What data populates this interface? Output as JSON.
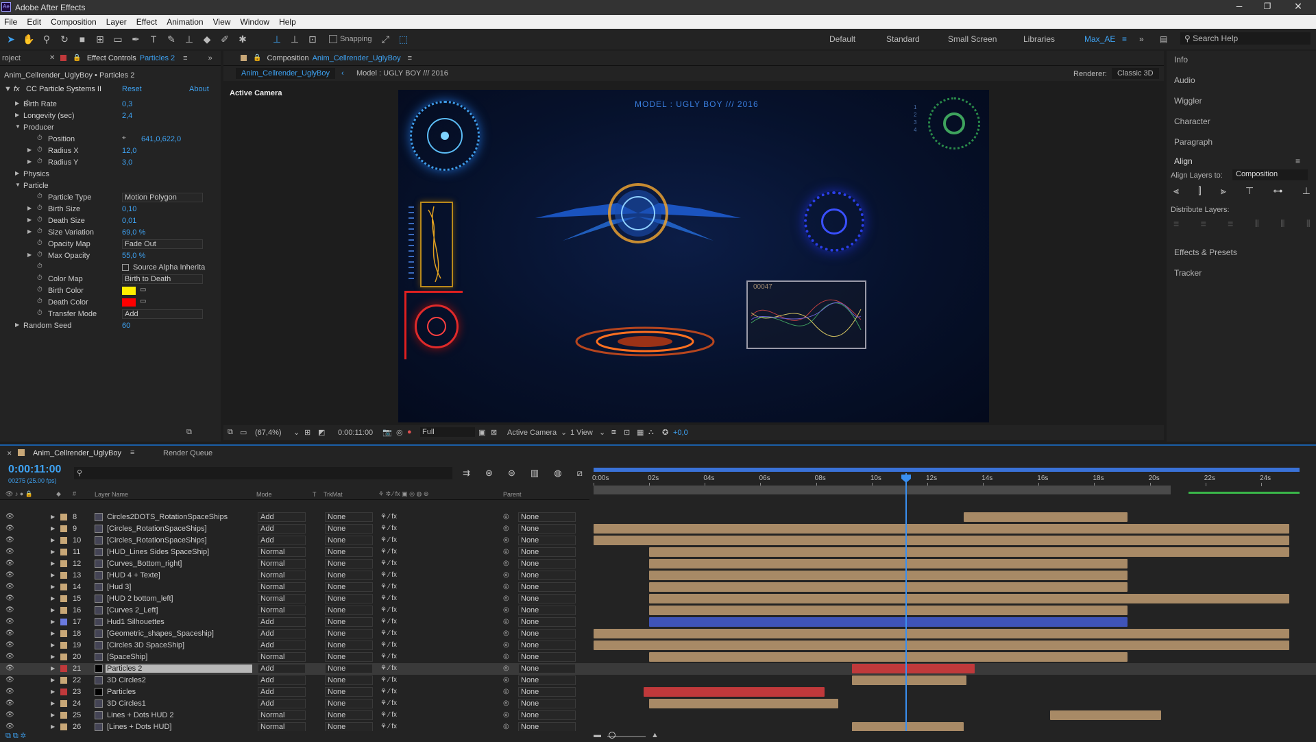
{
  "app": {
    "title": "Adobe After Effects",
    "icon": "Ae"
  },
  "menu": [
    "File",
    "Edit",
    "Composition",
    "Layer",
    "Effect",
    "Animation",
    "View",
    "Window",
    "Help"
  ],
  "toolbar": {
    "snapping_label": "Snapping",
    "search_placeholder": "Search Help"
  },
  "workspaces": [
    "Default",
    "Standard",
    "Small Screen",
    "Libraries",
    "Max_AE"
  ],
  "effect_panel": {
    "tab_project": "roject",
    "tab_label": "Effect Controls",
    "tab_layer": "Particles 2",
    "breadcrumb": "Anim_Cellrender_UglyBoy • Particles 2",
    "effect_name": "CC Particle Systems II",
    "reset": "Reset",
    "about": "About",
    "rows": [
      {
        "label": "Birth Rate",
        "value": "0,3"
      },
      {
        "label": "Longevity (sec)",
        "value": "2,4"
      },
      {
        "label": "Producer",
        "value": ""
      },
      {
        "label": "Position",
        "value": "641,0,622,0"
      },
      {
        "label": "Radius X",
        "value": "12,0"
      },
      {
        "label": "Radius Y",
        "value": "3,0"
      },
      {
        "label": "Physics",
        "value": ""
      },
      {
        "label": "Particle",
        "value": ""
      },
      {
        "label": "Particle Type",
        "value": "Motion Polygon"
      },
      {
        "label": "Birth Size",
        "value": "0,10"
      },
      {
        "label": "Death Size",
        "value": "0,01"
      },
      {
        "label": "Size Variation",
        "value": "69,0 %"
      },
      {
        "label": "Opacity Map",
        "value": "Fade Out"
      },
      {
        "label": "Max Opacity",
        "value": "55,0 %"
      },
      {
        "label": "",
        "value": "Source Alpha Inherita"
      },
      {
        "label": "Color Map",
        "value": "Birth to Death"
      },
      {
        "label": "Birth Color",
        "value": ""
      },
      {
        "label": "Death Color",
        "value": ""
      },
      {
        "label": "Transfer Mode",
        "value": "Add"
      },
      {
        "label": "Random Seed",
        "value": "60"
      }
    ],
    "colors": {
      "birth": "#ffee00",
      "death": "#ff0000"
    }
  },
  "composition": {
    "tab_prefix": "Composition",
    "tab_name": "Anim_Cellrender_UglyBoy",
    "sub_tab": "Anim_Cellrender_UglyBoy",
    "model_label": "Model : UGLY BOY /// 2016",
    "renderer_label": "Renderer:",
    "renderer": "Classic 3D",
    "view_label": "Active Camera",
    "overlay_title": "MODEL : UGLY BOY /// 2016",
    "counter": "00047",
    "side_digits": "1 2 3 4"
  },
  "viewer_bar": {
    "zoom": "(67,4%)",
    "time": "0:00:11:00",
    "resolution": "Full",
    "camera": "Active Camera",
    "views": "1 View",
    "exposure": "+0,0"
  },
  "right_panel": {
    "items": [
      "Info",
      "Audio",
      "Wiggler",
      "Character",
      "Paragraph"
    ],
    "align_title": "Align",
    "align_to_label": "Align Layers to:",
    "align_to": "Composition",
    "distribute_label": "Distribute Layers:",
    "tail": [
      "Effects & Presets",
      "Tracker"
    ]
  },
  "timeline": {
    "tab": "Anim_Cellrender_UglyBoy",
    "render_queue": "Render Queue",
    "timecode": "0:00:11:00",
    "frames": "00275 (25.00 fps)",
    "col_headers": {
      "layer": "Layer Name",
      "mode": "Mode",
      "t": "T",
      "trkmat": "TrkMat",
      "parent": "Parent"
    },
    "ruler": [
      "0:00s",
      "02s",
      "04s",
      "06s",
      "08s",
      "10s",
      "12s",
      "14s",
      "16s",
      "18s",
      "20s",
      "22s",
      "24s"
    ],
    "layers": [
      {
        "num": "8",
        "name": "Circles2DOTS_RotationSpaceShips",
        "mode": "Add",
        "trk": "None",
        "parent": "None",
        "color": "#a88a66",
        "start": 13.3,
        "end": 19.2
      },
      {
        "num": "9",
        "name": "[Circles_RotationSpaceShips]",
        "mode": "Add",
        "trk": "None",
        "parent": "None",
        "color": "#a88a66",
        "start": 0,
        "end": 25
      },
      {
        "num": "10",
        "name": "[Circles_RotationSpaceShips]",
        "mode": "Add",
        "trk": "None",
        "parent": "None",
        "color": "#a88a66",
        "start": 0,
        "end": 25
      },
      {
        "num": "11",
        "name": "[HUD_Lines Sides SpaceShip]",
        "mode": "Normal",
        "trk": "None",
        "parent": "None",
        "color": "#a88a66",
        "start": 2,
        "end": 25
      },
      {
        "num": "12",
        "name": "[Curves_Bottom_right]",
        "mode": "Normal",
        "trk": "None",
        "parent": "None",
        "color": "#a88a66",
        "start": 2,
        "end": 19.2
      },
      {
        "num": "13",
        "name": "[HUD 4 + Texte]",
        "mode": "Normal",
        "trk": "None",
        "parent": "None",
        "color": "#a88a66",
        "start": 2,
        "end": 19.2
      },
      {
        "num": "14",
        "name": "[Hud 3]",
        "mode": "Normal",
        "trk": "None",
        "parent": "None",
        "color": "#a88a66",
        "start": 2,
        "end": 19.2
      },
      {
        "num": "15",
        "name": "[HUD 2 bottom_left]",
        "mode": "Normal",
        "trk": "None",
        "parent": "None",
        "color": "#a88a66",
        "start": 2,
        "end": 25
      },
      {
        "num": "16",
        "name": "[Curves 2_Left]",
        "mode": "Normal",
        "trk": "None",
        "parent": "None",
        "color": "#a88a66",
        "start": 2,
        "end": 19.2
      },
      {
        "num": "17",
        "name": "Hud1 Silhouettes",
        "mode": "Add",
        "trk": "None",
        "parent": "None",
        "color": "#3f54b8",
        "start": 2,
        "end": 19.2
      },
      {
        "num": "18",
        "name": "[Geometric_shapes_Spaceship]",
        "mode": "Add",
        "trk": "None",
        "parent": "None",
        "color": "#a88a66",
        "start": 0,
        "end": 25
      },
      {
        "num": "19",
        "name": "[Circles 3D SpaceShip]",
        "mode": "Add",
        "trk": "None",
        "parent": "None",
        "color": "#a88a66",
        "start": 0,
        "end": 25
      },
      {
        "num": "20",
        "name": "[SpaceShip]",
        "mode": "Normal",
        "trk": "None",
        "parent": "None",
        "color": "#a88a66",
        "start": 2,
        "end": 19.2
      },
      {
        "num": "21",
        "name": "Particles 2",
        "mode": "Add",
        "trk": "None",
        "parent": "None",
        "color": "#c0393b",
        "start": 9.3,
        "end": 13.7
      },
      {
        "num": "22",
        "name": "3D Circles2",
        "mode": "Add",
        "trk": "None",
        "parent": "None",
        "color": "#a88a66",
        "start": 9.3,
        "end": 13.4
      },
      {
        "num": "23",
        "name": "Particles",
        "mode": "Add",
        "trk": "None",
        "parent": "None",
        "color": "#c0393b",
        "start": 1.8,
        "end": 8.3
      },
      {
        "num": "24",
        "name": "3D Circles1",
        "mode": "Add",
        "trk": "None",
        "parent": "None",
        "color": "#a88a66",
        "start": 2,
        "end": 8.8
      },
      {
        "num": "25",
        "name": "Lines + Dots HUD 2",
        "mode": "Normal",
        "trk": "None",
        "parent": "None",
        "color": "#a88a66",
        "start": 16.4,
        "end": 20.4
      },
      {
        "num": "26",
        "name": "[Lines + Dots HUD]",
        "mode": "Normal",
        "trk": "None",
        "parent": "None",
        "color": "#a88a66",
        "start": 9.3,
        "end": 13.3
      }
    ]
  }
}
